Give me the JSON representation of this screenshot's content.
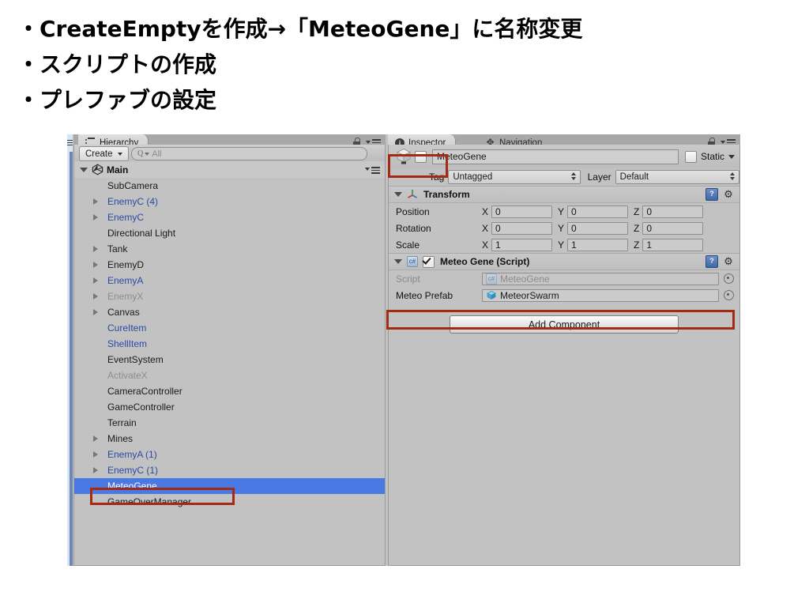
{
  "slide": {
    "bullets": [
      "・CreateEmptyを作成→「MeteoGene」に名称変更",
      "・スクリプトの作成",
      "・プレファブの設定"
    ]
  },
  "colors": {
    "selection_blue": "#4b79e4",
    "prefab_blue": "#2c49a3",
    "disabled_gray": "#8d8d8d",
    "annotation_red": "#a52a13",
    "panel_gray": "#c2c2c2"
  },
  "hierarchy": {
    "tab_label": "Hierarchy",
    "tab_icon": "hierarchy-list-icon",
    "toolbar": {
      "create_label": "Create",
      "search_placeholder": "All",
      "search_value": ""
    },
    "scene": {
      "name": "Main",
      "expanded": true,
      "icon": "unity-scene-icon"
    },
    "items": [
      {
        "label": "SubCamera",
        "expandable": false,
        "state": "normal"
      },
      {
        "label": "EnemyC (4)",
        "expandable": true,
        "state": "prefab"
      },
      {
        "label": "EnemyC",
        "expandable": true,
        "state": "prefab"
      },
      {
        "label": "Directional Light",
        "expandable": false,
        "state": "normal"
      },
      {
        "label": "Tank",
        "expandable": true,
        "state": "normal"
      },
      {
        "label": "EnemyD",
        "expandable": true,
        "state": "normal"
      },
      {
        "label": "EnemyA",
        "expandable": true,
        "state": "prefab"
      },
      {
        "label": "EnemyX",
        "expandable": true,
        "state": "disabled"
      },
      {
        "label": "Canvas",
        "expandable": true,
        "state": "normal"
      },
      {
        "label": "CureItem",
        "expandable": false,
        "state": "prefab"
      },
      {
        "label": "ShellItem",
        "expandable": false,
        "state": "prefab"
      },
      {
        "label": "EventSystem",
        "expandable": false,
        "state": "normal"
      },
      {
        "label": "ActivateX",
        "expandable": false,
        "state": "disabled"
      },
      {
        "label": "CameraController",
        "expandable": false,
        "state": "normal"
      },
      {
        "label": "GameController",
        "expandable": false,
        "state": "normal"
      },
      {
        "label": "Terrain",
        "expandable": false,
        "state": "normal"
      },
      {
        "label": "Mines",
        "expandable": true,
        "state": "normal"
      },
      {
        "label": "EnemyA (1)",
        "expandable": true,
        "state": "prefab"
      },
      {
        "label": "EnemyC (1)",
        "expandable": true,
        "state": "prefab"
      },
      {
        "label": "MeteoGene",
        "expandable": false,
        "state": "selected"
      },
      {
        "label": "GameOverManager",
        "expandable": false,
        "state": "normal"
      }
    ]
  },
  "inspector": {
    "tabs": [
      {
        "label": "Inspector",
        "icon": "info-icon",
        "active": true
      },
      {
        "label": "Navigation",
        "icon": "navigation-icon",
        "active": false
      }
    ],
    "object_header": {
      "icon": "gameobject-cube-icon",
      "active_checked": false,
      "name": "MeteoGene",
      "static_label": "Static",
      "static_checked": false
    },
    "tag_layer": {
      "tag_label": "Tag",
      "tag_value": "Untagged",
      "layer_label": "Layer",
      "layer_value": "Default"
    },
    "transform": {
      "title": "Transform",
      "icon": "transform-axis-icon",
      "expanded": true,
      "rows": [
        {
          "label": "Position",
          "x": "0",
          "y": "0",
          "z": "0"
        },
        {
          "label": "Rotation",
          "x": "0",
          "y": "0",
          "z": "0"
        },
        {
          "label": "Scale",
          "x": "1",
          "y": "1",
          "z": "1"
        }
      ],
      "axis_labels": {
        "x": "X",
        "y": "Y",
        "z": "Z"
      }
    },
    "script_component": {
      "title": "Meteo Gene (Script)",
      "icon": "csharp-script-icon",
      "enabled": true,
      "expanded": true,
      "script_row": {
        "label": "Script",
        "value": "MeteoGene"
      },
      "prefab_row": {
        "label": "Meteo Prefab",
        "value": "MeteorSwarm"
      }
    },
    "add_component_label": "Add Component"
  }
}
